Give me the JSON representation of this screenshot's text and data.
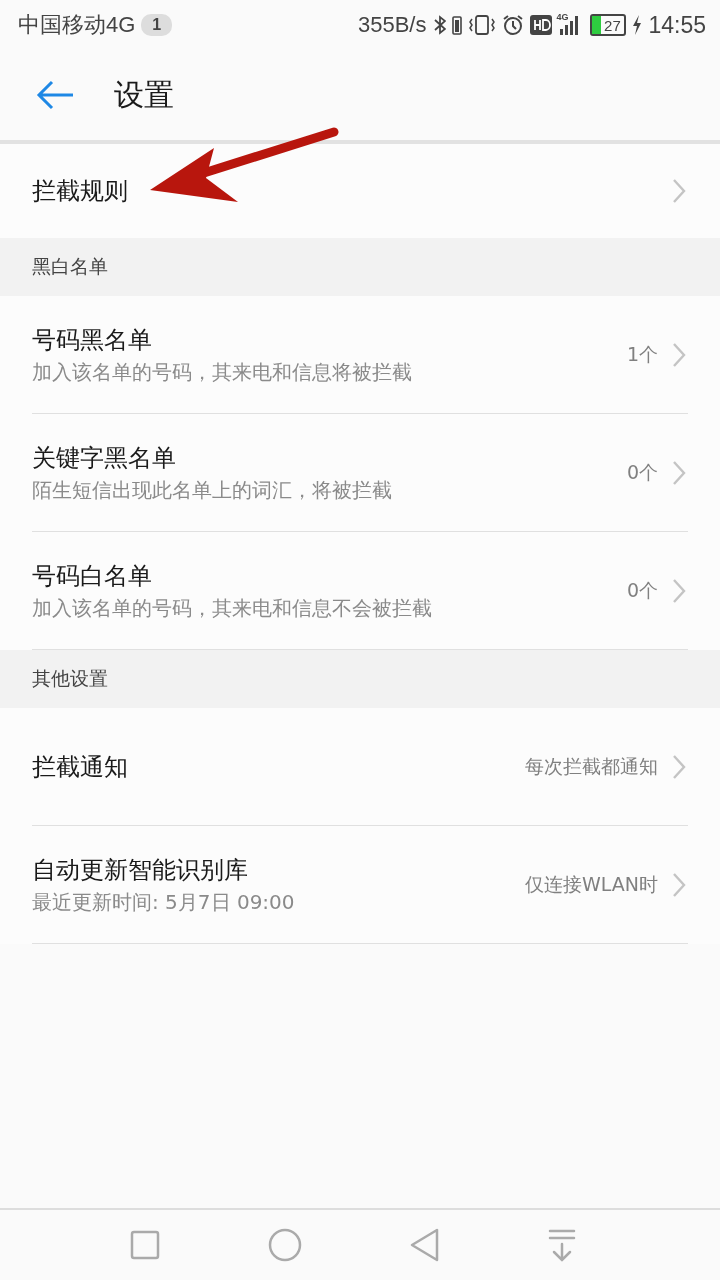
{
  "status_bar": {
    "carrier": "中国移动4G",
    "sim_badge": "1",
    "speed": "355B/s",
    "network": "4G",
    "battery_text": "27",
    "time": "14:55"
  },
  "header": {
    "title": "设置"
  },
  "top_item": {
    "label": "拦截规则"
  },
  "sections": [
    {
      "title": "黑白名单",
      "items": [
        {
          "label": "号码黑名单",
          "subtitle": "加入该名单的号码，其来电和信息将被拦截",
          "value": "1个"
        },
        {
          "label": "关键字黑名单",
          "subtitle": "陌生短信出现此名单上的词汇，将被拦截",
          "value": "0个"
        },
        {
          "label": "号码白名单",
          "subtitle": "加入该名单的号码，其来电和信息不会被拦截",
          "value": "0个"
        }
      ]
    },
    {
      "title": "其他设置",
      "items": [
        {
          "label": "拦截通知",
          "value": "每次拦截都通知"
        },
        {
          "label": "自动更新智能识别库",
          "subtitle": "最近更新时间: 5月7日 09:00",
          "value": "仅连接WLAN时"
        }
      ]
    }
  ],
  "annotation": {
    "kind": "arrow"
  }
}
